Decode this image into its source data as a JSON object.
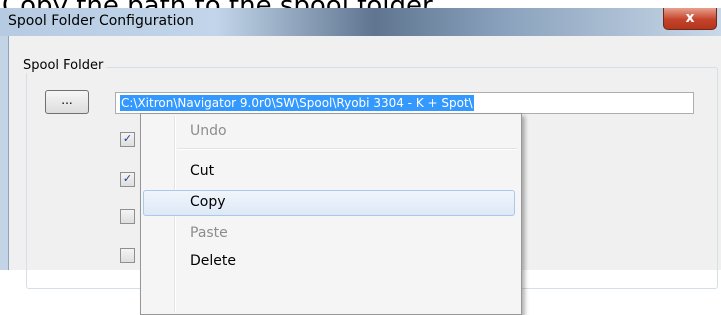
{
  "instruction": "Copy the path to the spool folder.",
  "window": {
    "title": "Spool Folder Configuration",
    "close_glyph": "x"
  },
  "group": {
    "label": "Spool Folder",
    "browse_label": "...",
    "path_value": "C:\\Xitron\\Navigator 9.0r0\\SW\\Spool\\Ryobi 3304 - K + Spot\\"
  },
  "checkboxes": [
    {
      "checked": true,
      "glyph": "✓"
    },
    {
      "checked": true,
      "glyph": "✓"
    },
    {
      "checked": false,
      "glyph": ""
    },
    {
      "checked": false,
      "glyph": ""
    }
  ],
  "context_menu": {
    "items": [
      {
        "label": "Undo",
        "state": "disabled"
      },
      {
        "label": "Cut",
        "state": "normal"
      },
      {
        "label": "Copy",
        "state": "hover"
      },
      {
        "label": "Paste",
        "state": "disabled"
      },
      {
        "label": "Delete",
        "state": "normal"
      }
    ]
  }
}
